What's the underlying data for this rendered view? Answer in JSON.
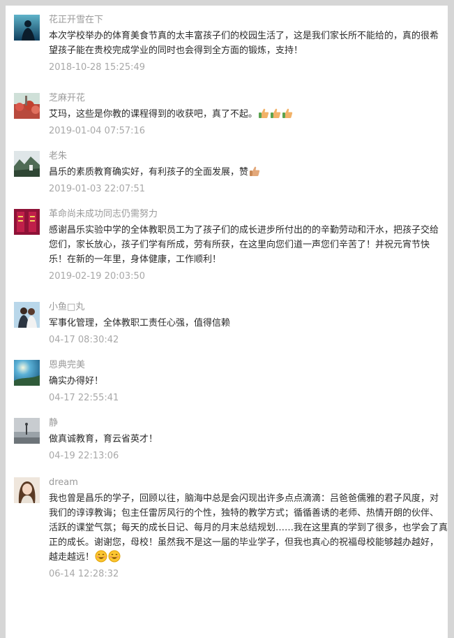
{
  "comments": [
    {
      "name": "花正开雪在下",
      "lines": [
        "本次学校举办的体育美食节真的太丰富孩子们的校园生活了，这是我们家长所不能给的，真的很希",
        "望孩子能在贵校完成学业的同时也会得到全方面的锻炼，支持！"
      ],
      "time": "2018-10-28 15:25:49",
      "avatar_icon": "silhouette-on-teal-avatar-icon"
    },
    {
      "name": "芝麻开花",
      "lines": [
        "艾玛，这些是你教的课程得到的收获吧，真了不起。"
      ],
      "emoji": [
        "thumbs-up-icon",
        "thumbs-up-icon",
        "thumbs-up-icon"
      ],
      "time": "2019-01-04 07:57:16",
      "avatar_icon": "red-flowers-avatar-icon"
    },
    {
      "name": "老朱",
      "lines": [
        "昌乐的素质教育确实好，有利孩子的全面发展，赞"
      ],
      "emoji": [
        "thumbs-up-icon"
      ],
      "time": "2019-01-03 22:07:51",
      "avatar_icon": "mountain-landscape-avatar-icon"
    },
    {
      "name": "革命尚未成功同志仍需努力",
      "lines": [
        "感谢昌乐实验中学的全体教职员工为了孩子们的成长进步所付出的的辛勤劳动和汗水，把孩子交给",
        "您们，家长放心，孩子们学有所成，劳有所获，在这里向您们道一声您们辛苦了！并祝元宵节快",
        "乐！在新的一年里，身体健康，工作顺利！"
      ],
      "time": "2019-02-19 20:03:50",
      "avatar_icon": "red-banner-avatar-icon"
    },
    {
      "name": "小鱼□丸",
      "lines": [
        "军事化管理，全体教职工责任心强，值得信赖"
      ],
      "time": "04-17 08:30:42",
      "avatar_icon": "couple-photo-avatar-icon"
    },
    {
      "name": "恩典完美",
      "lines": [
        "确实办得好！"
      ],
      "time": "04-17 22:55:41",
      "avatar_icon": "blue-sky-avatar-icon"
    },
    {
      "name": "静",
      "lines": [
        "做真诚教育，育云省英才！"
      ],
      "time": "04-19 22:13:06",
      "avatar_icon": "foggy-lake-avatar-icon"
    },
    {
      "name": "dream",
      "lines": [
        "我也曾是昌乐的学子，回顾以往，脑海中总是会闪现出许多点点滴滴：吕爸爸儒雅的君子风度，对",
        "我们的谆谆教诲；包主任雷厉风行的个性，独特的教学方式；循循善诱的老师、热情开朗的伙伴、",
        "活跃的课堂气氛；每天的成长日记、每月的月末总结规划……我在这里真的学到了很多，也学会了真",
        "正的成长。谢谢您，母校！虽然我不是这一届的毕业学子，但我也真心的祝福母校能够越办越好，",
        "越走越远！"
      ],
      "emoji": [
        "smile-icon",
        "smile-icon"
      ],
      "time": "06-14 12:28:32",
      "avatar_icon": "girl-portrait-avatar-icon"
    }
  ],
  "colors": {
    "name": "#9a9a9a",
    "text": "#2a2a2a",
    "time": "#a8a8a8",
    "background": "#d6d6d6",
    "panel": "#ffffff"
  }
}
